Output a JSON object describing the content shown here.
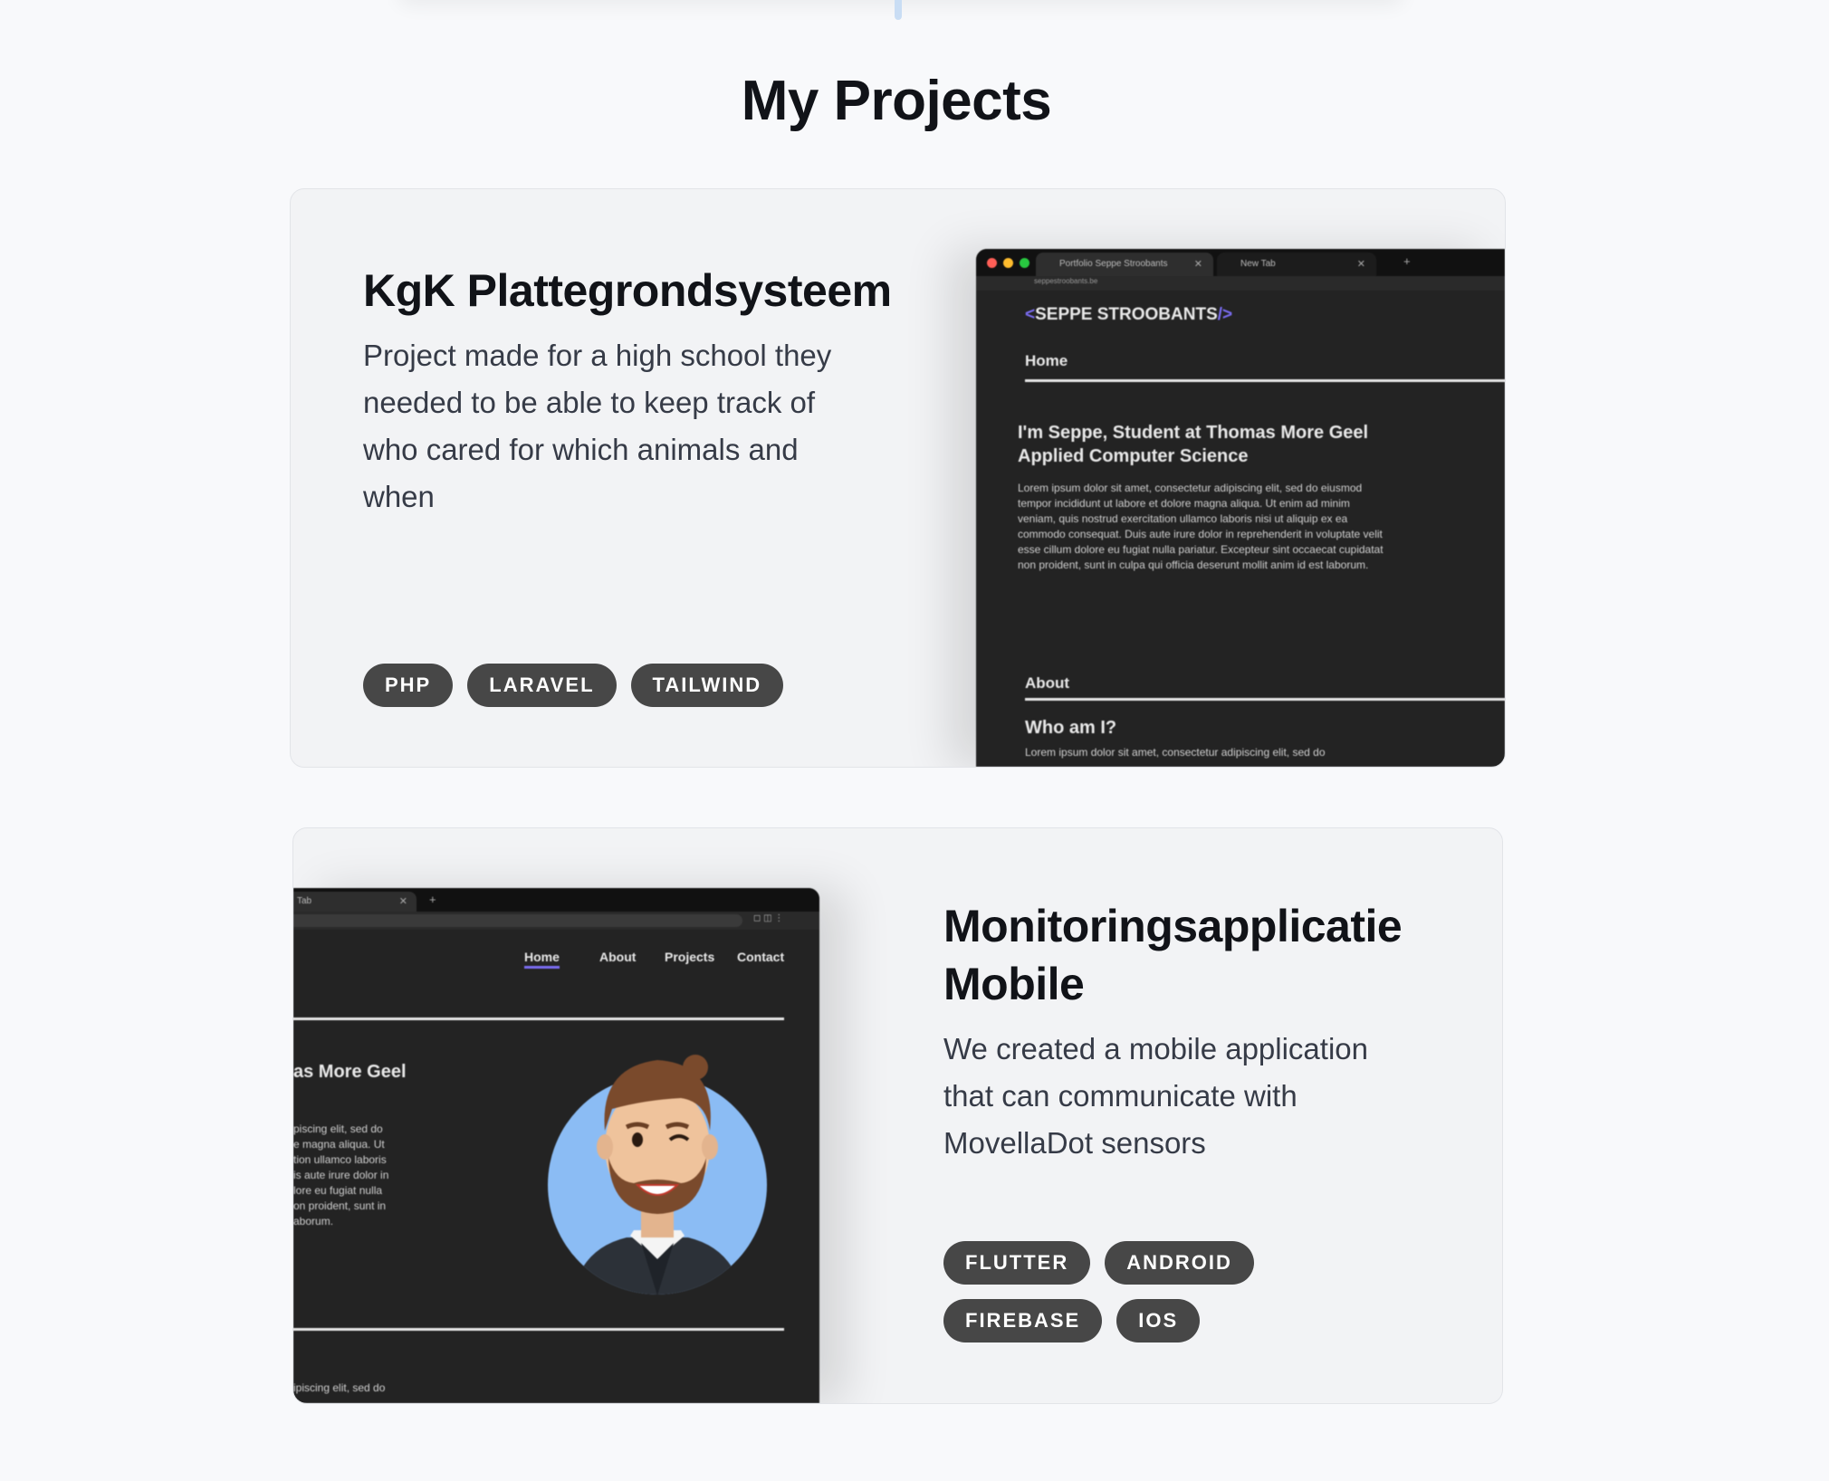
{
  "section": {
    "title": "My Projects"
  },
  "projects": [
    {
      "title": "KgK Plattegrondsysteem",
      "description": "Project made for a high school they needed to be able to keep track of who cared for which animals and when",
      "tags": [
        "PHP",
        "LARAVEL",
        "TAILWIND"
      ],
      "screenshot": {
        "tab1": "Portfolio Seppe Stroobants",
        "tab2": "New Tab",
        "url": "seppestroobants.be",
        "logo_open": "<",
        "logo_name": "SEPPE STROOBANTS",
        "logo_close": "/>",
        "nav_home": "Home",
        "heading": "I'm Seppe, Student at Thomas More Geel Applied Computer Science",
        "lorem": "Lorem ipsum dolor sit amet, consectetur adipiscing elit, sed do eiusmod tempor incididunt ut labore et dolore magna aliqua. Ut enim ad minim veniam, quis nostrud exercitation ullamco laboris nisi ut aliquip ex ea commodo consequat. Duis aute irure dolor in reprehenderit in voluptate velit esse cillum dolore eu fugiat nulla pariatur. Excepteur sint occaecat cupidatat non proident, sunt in culpa qui officia deserunt mollit anim id est laborum.",
        "about": "About",
        "who": "Who am I?",
        "lorem_short": "Lorem ipsum dolor sit amet, consectetur adipiscing elit, sed do"
      }
    },
    {
      "title": "Monitoringsapplicatie Mobile",
      "description": "We created a mobile application that can communicate with MovellaDot sensors",
      "tags": [
        "FLUTTER",
        "ANDROID",
        "FIREBASE",
        "IOS"
      ],
      "screenshot": {
        "tab": "Tab",
        "nav": [
          "Home",
          "About",
          "Projects",
          "Contact"
        ],
        "heading_fragment": "as More Geel",
        "lorem_fragment": "piscing elit, sed do\ne magna aliqua. Ut\ntion ullamco laboris\nis aute irure dolor in\nlore eu fugiat nulla\non proident, sunt in\naborum.",
        "bottom_fragment": "ipiscing elit, sed do"
      }
    }
  ],
  "colors": {
    "background": "#f8f9fb",
    "card": "#f2f3f5",
    "tag": "#474747",
    "screenshot_bg": "#232323",
    "accent": "#7a6cf0",
    "avatar_circle": "#8bbcf4"
  }
}
